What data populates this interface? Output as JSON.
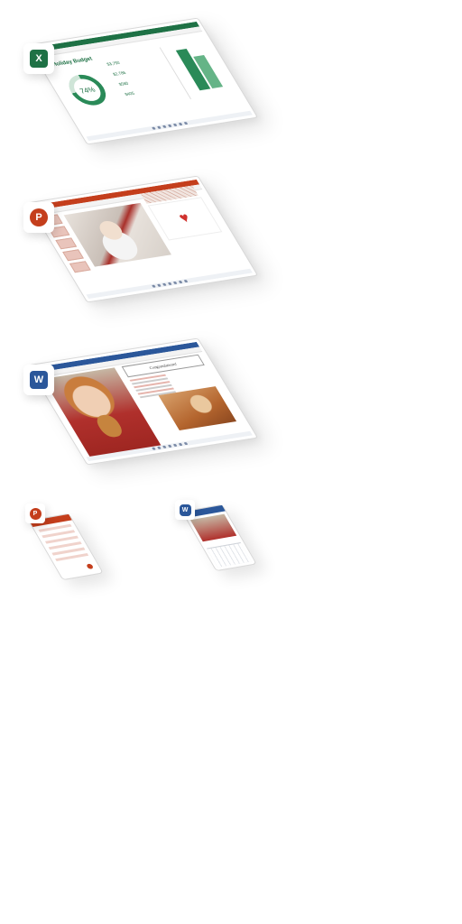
{
  "excel": {
    "app_letter": "X",
    "title": "Holiday Budget",
    "percent": "74%",
    "values": [
      "$3,750",
      "$2,786",
      "$560",
      "$405"
    ],
    "colors": {
      "brand": "#1e7145"
    }
  },
  "powerpoint": {
    "app_letter": "P",
    "colors": {
      "brand": "#c43e1c"
    },
    "icon": "heart-icon"
  },
  "word": {
    "app_letter": "W",
    "heading": "Congratulations!",
    "colors": {
      "brand": "#2b579a"
    }
  },
  "phones": {
    "left_app": "powerpoint",
    "right_app": "word"
  }
}
